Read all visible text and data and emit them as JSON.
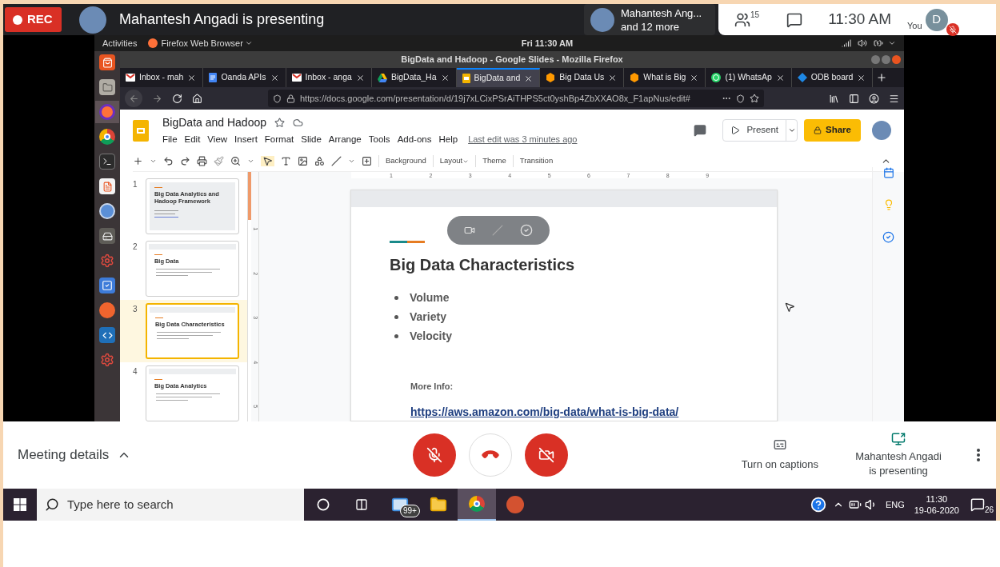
{
  "meet_top": {
    "rec": "REC",
    "presenter_text": "Mahantesh Angadi is presenting",
    "tile": {
      "name": "Mahantesh Ang...",
      "others": "and 12 more"
    },
    "people_count": "15",
    "time": "11:30 AM",
    "self": {
      "initial": "D",
      "label": "You",
      "mic_on": false
    }
  },
  "desktop": {
    "activities": "Activities",
    "app_menu": "Firefox Web Browser",
    "clock": "Fri 11:30 AM",
    "launcher": [
      {
        "kind": "store",
        "selected": false
      },
      {
        "kind": "files",
        "selected": false
      },
      {
        "kind": "firefox",
        "selected": true
      },
      {
        "kind": "chrome",
        "selected": false
      },
      {
        "kind": "terminal",
        "selected": false
      },
      {
        "kind": "editor",
        "selected": false
      },
      {
        "kind": "r",
        "selected": false
      },
      {
        "kind": "disk",
        "selected": false
      },
      {
        "kind": "gear",
        "selected": false
      },
      {
        "kind": "check",
        "selected": false
      },
      {
        "kind": "git",
        "selected": false
      },
      {
        "kind": "code",
        "selected": false
      },
      {
        "kind": "gear",
        "selected": false
      }
    ]
  },
  "firefox": {
    "title": "BigData and Hadoop - Google Slides - Mozilla Firefox",
    "tabs": [
      {
        "label": "Inbox - mah",
        "kind": "gmail",
        "selected": false
      },
      {
        "label": "Oanda APIs",
        "kind": "docs",
        "selected": false
      },
      {
        "label": "Inbox - anga",
        "kind": "gmail",
        "selected": false
      },
      {
        "label": "BigData_Ha",
        "kind": "drive",
        "selected": false
      },
      {
        "label": "BigData and",
        "kind": "slides",
        "selected": true
      },
      {
        "label": "Big Data Us",
        "kind": "hex",
        "selected": false
      },
      {
        "label": "What is Big",
        "kind": "hex",
        "selected": false
      },
      {
        "label": "(1) WhatsAp",
        "kind": "whatsapp",
        "selected": false
      },
      {
        "label": "ODB board",
        "kind": "diamond",
        "selected": false
      }
    ],
    "url": "https://docs.google.com/presentation/d/19j7xLCixPSrAiTHPS5ct0yshBp4ZbXXAO8x_F1apNus/edit#"
  },
  "slides": {
    "doc_title": "BigData and Hadoop",
    "menu": [
      "File",
      "Edit",
      "View",
      "Insert",
      "Format",
      "Slide",
      "Arrange",
      "Tools",
      "Add-ons",
      "Help"
    ],
    "last_edit": "Last edit was 3 minutes ago",
    "present": "Present",
    "share": "Share",
    "toolbar": [
      "Background",
      "Layout",
      "Theme",
      "Transition"
    ],
    "thumbnails": [
      {
        "number": "1",
        "title": "Big Data Analytics and Hadoop Framework",
        "kind": "cover",
        "selected": false
      },
      {
        "number": "2",
        "title": "Big Data",
        "kind": "content",
        "selected": false
      },
      {
        "number": "3",
        "title": "Big Data Characteristics",
        "kind": "content",
        "selected": true
      },
      {
        "number": "4",
        "title": "Big Data Analytics",
        "kind": "content",
        "selected": false
      }
    ],
    "ruler_h": [
      "1",
      "2",
      "3",
      "4",
      "5",
      "6",
      "7",
      "8",
      "9"
    ],
    "ruler_v": [
      "1",
      "2",
      "3",
      "4",
      "5"
    ],
    "slide": {
      "title": "Big Data Characteristics",
      "bullets": [
        "Volume",
        "Variety",
        "Velocity"
      ],
      "more_info": "More Info:",
      "link": "https://aws.amazon.com/big-data/what-is-big-data/"
    }
  },
  "meet_bottom": {
    "meeting_details": "Meeting details",
    "controls": [
      {
        "kind": "mic",
        "on": false
      },
      {
        "kind": "hangup",
        "on": true
      },
      {
        "kind": "camera",
        "on": false
      }
    ],
    "captions": "Turn on captions",
    "presenting": "Mahantesh Angadi is presenting"
  },
  "taskbar": {
    "search_placeholder": "Type here to search",
    "apps": [
      {
        "kind": "mail",
        "badge": "99+",
        "selected": false
      },
      {
        "kind": "explorer",
        "selected": false
      },
      {
        "kind": "chrome",
        "selected": true
      },
      {
        "kind": "powerpoint",
        "selected": false
      }
    ],
    "language": "ENG",
    "time": "11:30",
    "date": "19-06-2020",
    "notifications": "26"
  }
}
